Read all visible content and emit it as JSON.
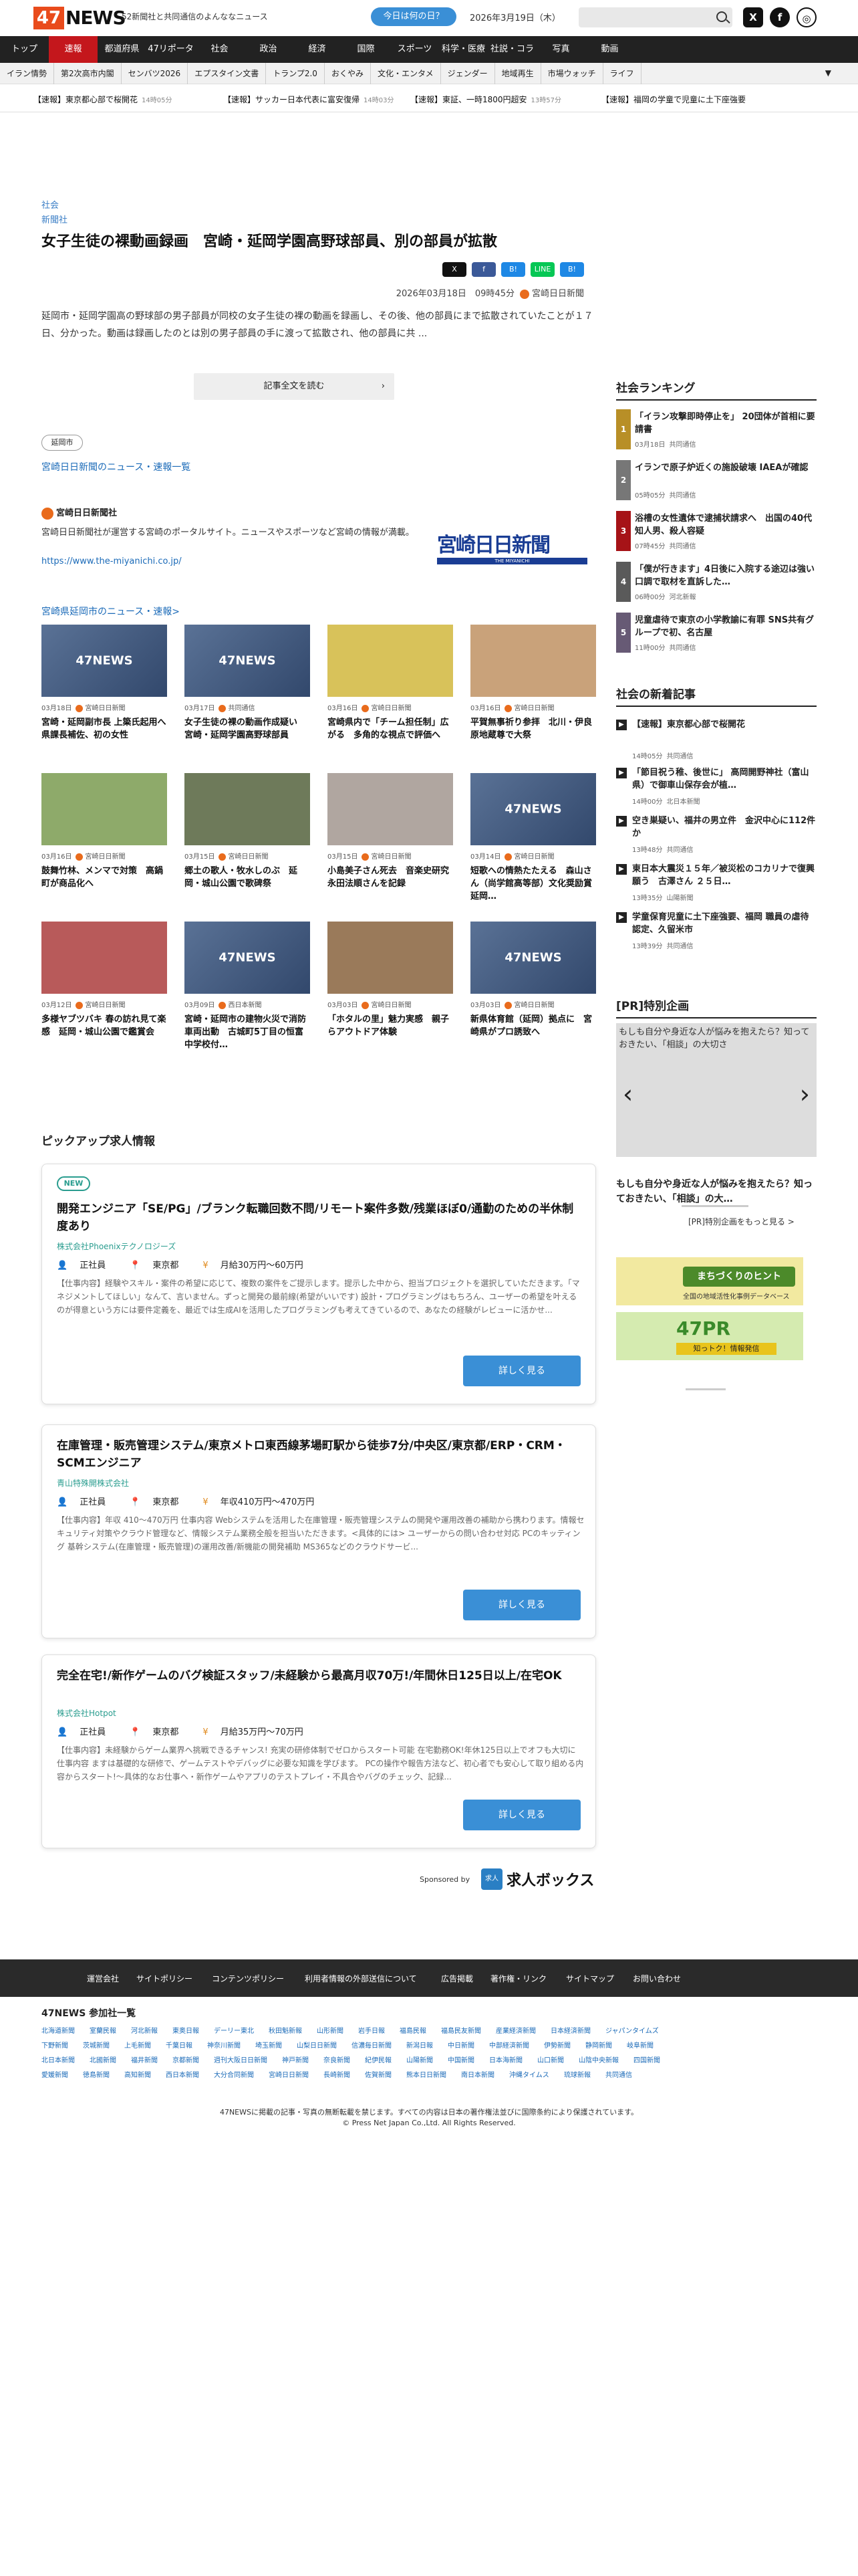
{
  "header": {
    "logo": "47NEWS",
    "tagline": "52新聞社と共同通信のよんななニュース",
    "today_button": "今日は何の日？",
    "date": "2026年3月19日（木）"
  },
  "nav": [
    "トップ",
    "速報",
    "都道府県",
    "47リポーターズ",
    "社会",
    "政治",
    "経済",
    "国際",
    "スポーツ",
    "科学・医療",
    "社説・コラム",
    "写真",
    "動画"
  ],
  "subnav": [
    "イラン情勢",
    "第2次高市内閣",
    "センバツ2026",
    "エプスタイン文書",
    "トランプ2.0",
    "おくやみ",
    "文化・エンタメ",
    "ジェンダー",
    "地域再生",
    "市場ウォッチ",
    "ライフ"
  ],
  "ticker": [
    {
      "text": "【速報】東京都心部で桜開花",
      "time": "14時05分"
    },
    {
      "text": "【速報】サッカー日本代表に富安復帰",
      "time": "14時03分"
    },
    {
      "text": "【速報】東証、一時1800円超安",
      "time": "13時57分"
    },
    {
      "text": "【速報】福岡の学童で児童に土下座強要",
      "time": ""
    }
  ],
  "article": {
    "category": "社会",
    "publisher_cat": "新聞社",
    "headline": "女子生徒の裸動画録画　宮崎・延岡学園高野球部員、別の部員が拡散",
    "share": [
      "X",
      "f",
      "B!",
      "LINE",
      "B!"
    ],
    "datetime": "2026年03月18日　09時45分",
    "source": "宮崎日日新聞",
    "lead": "延岡市・延岡学園高の野球部の男子部員が同校の女子生徒の裸の動画を録画し、その後、他の部員にまで拡散されていたことが１７日、分かった。動画は録画したのとは別の男子部員の手に渡って拡散され、他の部員に共 ...",
    "read_more": "記事全文を読む",
    "tag": "延岡市",
    "source_link": "宮崎日日新聞のニュース・速報一覧"
  },
  "publisher": {
    "name": "宮崎日日新聞社",
    "desc": "宮崎日日新聞社が運営する宮崎のポータルサイト。ニュースやスポーツなど宮崎の情報が満載。",
    "url": "https://www.the-miyanichi.co.jp/",
    "logo_text": "宮崎日日新聞",
    "logo_sub": "THE MIYANICHI"
  },
  "related": {
    "heading": "宮崎県延岡市のニュース・速報>",
    "cards": [
      {
        "date": "03月18日",
        "src": "宮崎日日新聞",
        "title": "宮崎・延岡副市長 上簗氏起用へ　県課長補佐、初の女性",
        "img": "47NEWS",
        "color": "#4a6288"
      },
      {
        "date": "03月17日",
        "src": "共同通信",
        "title": "女子生徒の裸の動画作成疑い　宮崎・延岡学園高野球部員",
        "img": "47NEWS",
        "color": "#4a6288"
      },
      {
        "date": "03月16日",
        "src": "宮崎日日新聞",
        "title": "宮崎県内で「チーム担任制」広がる　多角的な視点で評価へ",
        "img": "",
        "color": "#d8c25a"
      },
      {
        "date": "03月16日",
        "src": "宮崎日日新聞",
        "title": "平賀無事祈り参拝　北川・伊良原地蔵尊で大祭",
        "img": "",
        "color": "#c9a27a"
      },
      {
        "date": "03月16日",
        "src": "宮崎日日新聞",
        "title": "鼓舞竹林、メンマで対策　高鍋町が商品化へ",
        "img": "",
        "color": "#8eaa6a"
      },
      {
        "date": "03月15日",
        "src": "宮崎日日新聞",
        "title": "郷土の歌人・牧水しのぶ　延岡・城山公園で歌碑祭",
        "img": "",
        "color": "#6e7a5a"
      },
      {
        "date": "03月15日",
        "src": "宮崎日日新聞",
        "title": "小島美子さん死去　音楽史研究 永田法順さんを記録",
        "img": "",
        "color": "#b0a6a0"
      },
      {
        "date": "03月14日",
        "src": "宮崎日日新聞",
        "title": "短歌への情熱たたえる　森山さん（尚学館高等部）文化奨励賞　延岡…",
        "img": "47NEWS",
        "color": "#4a6288"
      },
      {
        "date": "03月12日",
        "src": "宮崎日日新聞",
        "title": "多様ヤブツバキ 春の訪れ見て楽感　延岡・城山公園で鑑賞会",
        "img": "",
        "color": "#b85a5a"
      },
      {
        "date": "03月09日",
        "src": "西日本新聞",
        "title": "宮崎・延岡市の建物火災で消防車両出動　古城町5丁目の恒富中学校付…",
        "img": "47NEWS",
        "color": "#4a6288"
      },
      {
        "date": "03月03日",
        "src": "宮崎日日新聞",
        "title": "「ホタルの里」魅力実感　親子らアウトドア体験",
        "img": "",
        "color": "#9a7a5a"
      },
      {
        "date": "03月03日",
        "src": "宮崎日日新聞",
        "title": "新県体育館（延岡）拠点に　宮崎県がプロ誘致へ",
        "img": "47NEWS",
        "color": "#4a6288"
      }
    ]
  },
  "sidebar": {
    "ranking_head": "社会ランキング",
    "ranking": [
      {
        "num": "1",
        "title": "「イラン攻撃即時停止を」 20団体が首相に要請書",
        "time": "03月18日",
        "src": "共同通信"
      },
      {
        "num": "2",
        "title": "イランで原子炉近くの施設破壊 IAEAが確認",
        "time": "05時05分",
        "src": "共同通信"
      },
      {
        "num": "3",
        "title": "浴槽の女性遺体で逮捕状請求へ　出国の40代知人男、殺人容疑",
        "time": "07時45分",
        "src": "共同通信"
      },
      {
        "num": "4",
        "title": "「僕が行きます」4日後に入院する途辺は強い口調で取材を直訴した…",
        "time": "06時00分",
        "src": "河北新報"
      },
      {
        "num": "5",
        "title": "児童虐待で東京の小学教諭に有罪 SNS共有グループで初、名古屋",
        "time": "11時00分",
        "src": "共同通信"
      }
    ],
    "newest_head": "社会の新着記事",
    "newest": [
      {
        "title": "【速報】東京都心部で桜開花",
        "time": "14時05分",
        "src": "共同通信"
      },
      {
        "title": "「節目祝う稚、後世に」 高岡開野神社（富山県）で御車山保存会が植…",
        "time": "14時00分",
        "src": "北日本新聞"
      },
      {
        "title": "空き巣疑い、福井の男立件　金沢中心に112件か",
        "time": "13時48分",
        "src": "共同通信"
      },
      {
        "title": "東日本大震災１５年／被災松のコカリナで復興願う　古澤さん ２５日…",
        "time": "13時35分",
        "src": "山陽新聞"
      },
      {
        "title": "学童保育児童に土下座強要、福岡 職員の虐待認定、久留米市",
        "time": "13時39分",
        "src": "共同通信"
      }
    ],
    "pr_head": "[PR]特別企画",
    "pr_alt": "もしも自分や身近な人が悩みを抱えたら？知っておきたい、「相談」の大切さ",
    "pr_text": "もしも自分や身近な人が悩みを抱えたら？知っておきたい、「相談」の大…",
    "pr_more": "[PR]特別企画をもっと見る >",
    "banner1": "まちづくりのヒント",
    "banner1_sub": "全国の地域活性化事例データベース",
    "banner2": "47PR",
    "banner2_sub": "知っトク！情報発信"
  },
  "jobs": {
    "heading": "ピックアップ求人情報",
    "items": [
      {
        "new": "NEW",
        "title": "開発エンジニア「SE/PG」/ブランク転職回数不問/リモート案件多数/残業ほぼ0/通勤のための半休制度あり",
        "company": "株式会社Phoenixテクノロジーズ",
        "type": "正社員",
        "place": "東京都",
        "salary": "月給30万円〜60万円",
        "desc": "【仕事内容】経験やスキル・案件の希望に応じて、複数の案件をご提示します。提示した中から、担当プロジェクトを選択していただきます。「マネジメントしてほしい」なんて、言いません。ずっと開発の最前線(希望がいいです) 設計・プログラミングはもちろん、ユーザーの希望を叶えるのが得意という方には要件定義を、最近では生成AIを活用したプログラミングも考えてきているので、あなたの経験がレビューに活かせ...",
        "button": "詳しく見る"
      },
      {
        "new": "",
        "title": "在庫管理・販売管理システム/東京メトロ東西線茅場町駅から徒歩7分/中央区/東京都/ERP・CRM・SCMエンジニア",
        "company": "青山特殊開株式会社",
        "type": "正社員",
        "place": "東京都",
        "salary": "年収410万円〜470万円",
        "desc": "【仕事内容】年収 410〜470万円 仕事内容 Webシステムを活用した在庫管理・販売管理システムの開発や運用改善の補助から携わります。情報セキュリティ対策やクラウド管理など、情報システム業務全般を担当いただきます。<具体的には> ユーザーからの問い合わせ対応 PCのキッティング 基幹システム(在庫管理・販売管理)の運用改善/新機能の開発補助 MS365などのクラウドサービ...",
        "button": "詳しく見る"
      },
      {
        "new": "",
        "title": "完全在宅!/新作ゲームのバグ検証スタッフ/未経験から最高月収70万!/年間休日125日以上/在宅OK",
        "company": "株式会社Hotpot",
        "type": "正社員",
        "place": "東京都",
        "salary": "月給35万円〜70万円",
        "desc": "【仕事内容】未経験からゲーム業界へ挑戦できるチャンス! 充実の研修体制でゼロからスタート可能 在宅勤務OK!年休125日以上でオフも大切に 仕事内容 ますは基礎的な研修で、ゲームテストやデバッグに必要な知識を学びます。 PCの操作や報告方法など、初心者でも安心して取り組める内容からスタート!～具体的なお仕事へ・新作ゲームやアプリのテストプレイ・不具合やバグのチェック、記録...",
        "button": "詳しく見る"
      }
    ],
    "sponsor_label": "Sponsored by",
    "sponsor_name": "求人ボックス",
    "sponsor_icon": "求人"
  },
  "footer": {
    "links": [
      "運営会社",
      "サイトポリシー",
      "コンテンツポリシー",
      "利用者情報の外部送信について",
      "広告掲載",
      "著作権・リンク",
      "サイトマップ",
      "お問い合わせ"
    ],
    "member_head": "47NEWS 参加社一覧",
    "members_row1": [
      "北海道新聞",
      "室蘭民報",
      "河北新報",
      "東奥日報",
      "デーリー東北",
      "秋田魁新報",
      "山形新聞",
      "岩手日報",
      "福島民報",
      "福島民友新聞",
      "産業経済新聞",
      "日本経済新聞",
      "ジャパンタイムズ"
    ],
    "members_row2": [
      "下野新聞",
      "茨城新聞",
      "上毛新聞",
      "千葉日報",
      "神奈川新聞",
      "埼玉新聞",
      "山梨日日新聞",
      "信濃毎日新聞",
      "新潟日報",
      "中日新聞",
      "中部経済新聞",
      "伊勢新聞",
      "静岡新聞",
      "岐阜新聞"
    ],
    "members_row3": [
      "北日本新聞",
      "北國新聞",
      "福井新聞",
      "京都新聞",
      "週刊大阪日日新聞",
      "神戸新聞",
      "奈良新聞",
      "紀伊民報",
      "山陽新聞",
      "中国新聞",
      "日本海新聞",
      "山口新聞",
      "山陰中央新報",
      "四国新聞"
    ],
    "members_row4": [
      "愛媛新聞",
      "徳島新聞",
      "高知新聞",
      "西日本新聞",
      "大分合同新聞",
      "宮崎日日新聞",
      "長崎新聞",
      "佐賀新聞",
      "熊本日日新聞",
      "南日本新聞",
      "沖縄タイムス",
      "琉球新報",
      "共同通信"
    ],
    "copy1": "47NEWSに掲載の記事・写真の無断転載を禁じます。すべての内容は日本の著作権法並びに国際条約により保護されています。",
    "copy2": "© Press Net Japan Co.,Ltd. All Rights Reserved."
  },
  "colors": {
    "accent": "#c4171c",
    "brand": "#e94b1c",
    "link": "#1a6ab8",
    "button": "#3a8fd6"
  }
}
